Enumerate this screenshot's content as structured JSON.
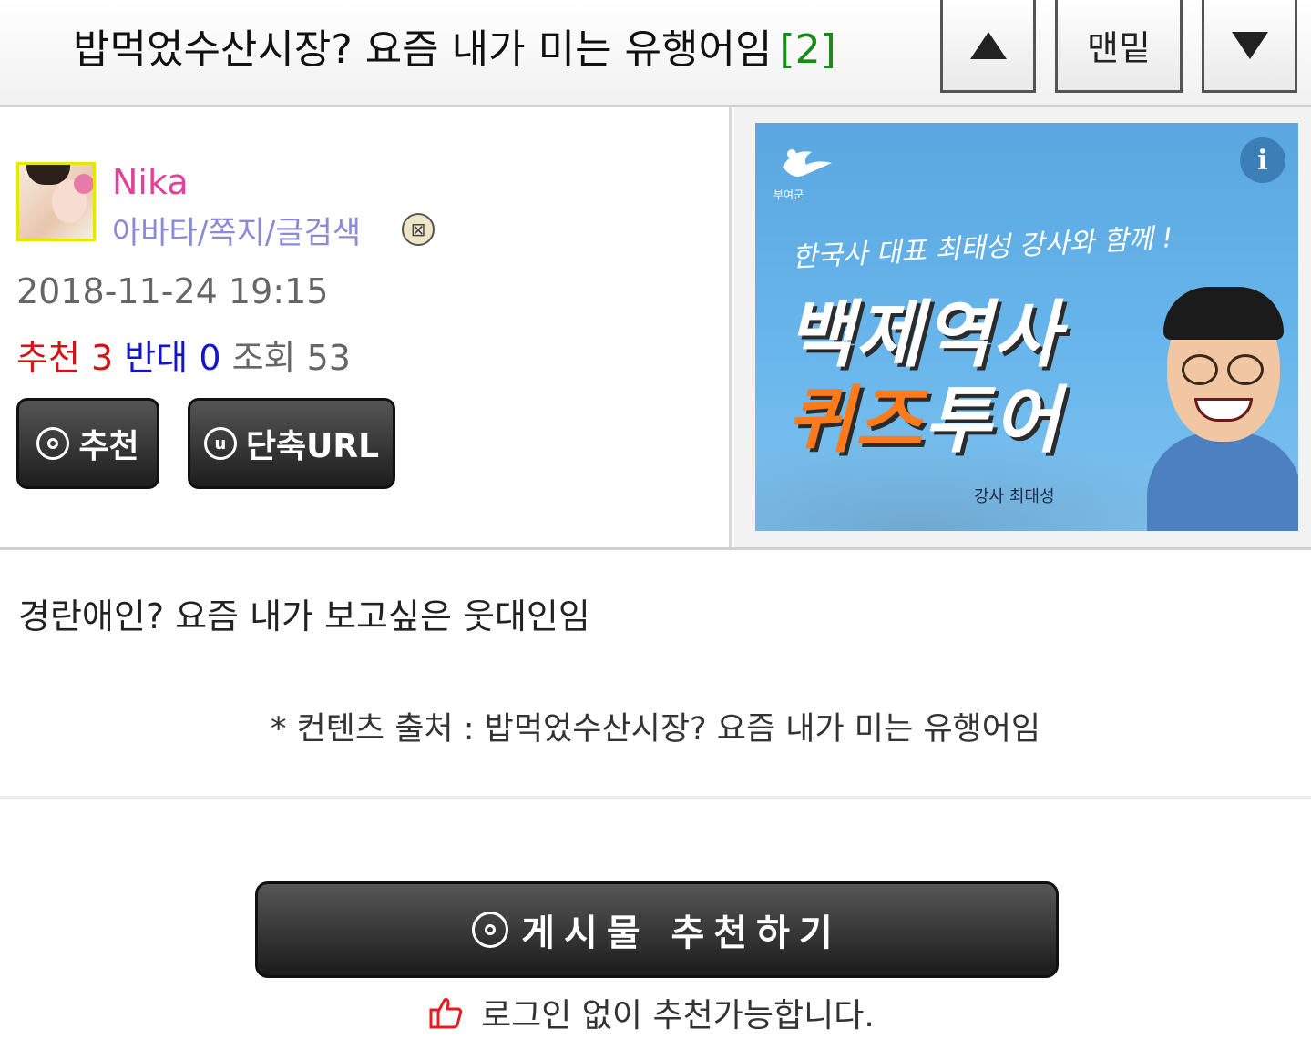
{
  "header": {
    "title": "밥먹었수산시장? 요즘 내가 미는 유행어임",
    "comment_count": "[2]",
    "up_icon": "triangle-up-icon",
    "bottom_label": "맨밑",
    "down_icon": "triangle-down-icon"
  },
  "author": {
    "nickname": "Nika",
    "links": "아바타/쪽지/글검색",
    "badge_icon": "level-badge-icon"
  },
  "post": {
    "date": "2018-11-24 19:15",
    "recommend_label": "추천",
    "recommend_value": "3",
    "oppose_label": "반대",
    "oppose_value": "0",
    "views_label": "조회",
    "views_value": "53",
    "content": "경란애인? 요즘 내가 보고싶은 웃대인임",
    "source": "* 컨텐츠 출처 : 밥먹었수산시장? 요즘 내가 미는 유행어임"
  },
  "buttons": {
    "recommend": "추천",
    "short_url": "단축URL",
    "short_url_icon_letter": "u",
    "recommend_post": "게시물 추천하기",
    "note": "로그인 없이 추천가능합니다."
  },
  "ad": {
    "logo_text": "부여군",
    "info": "i",
    "subtitle": "한국사 대표 최태성 강사와 함께 !",
    "line1": "백제역사",
    "line2_orange": "퀴즈",
    "line2_white": "투어",
    "teacher": "강사 최태성"
  },
  "colors": {
    "nickname": "#e0439a",
    "links": "#8a8ad6",
    "recommend": "#d01515",
    "oppose": "#1515c8",
    "comment_count": "#1a8a1a",
    "ad_orange": "#ff7a1a"
  }
}
